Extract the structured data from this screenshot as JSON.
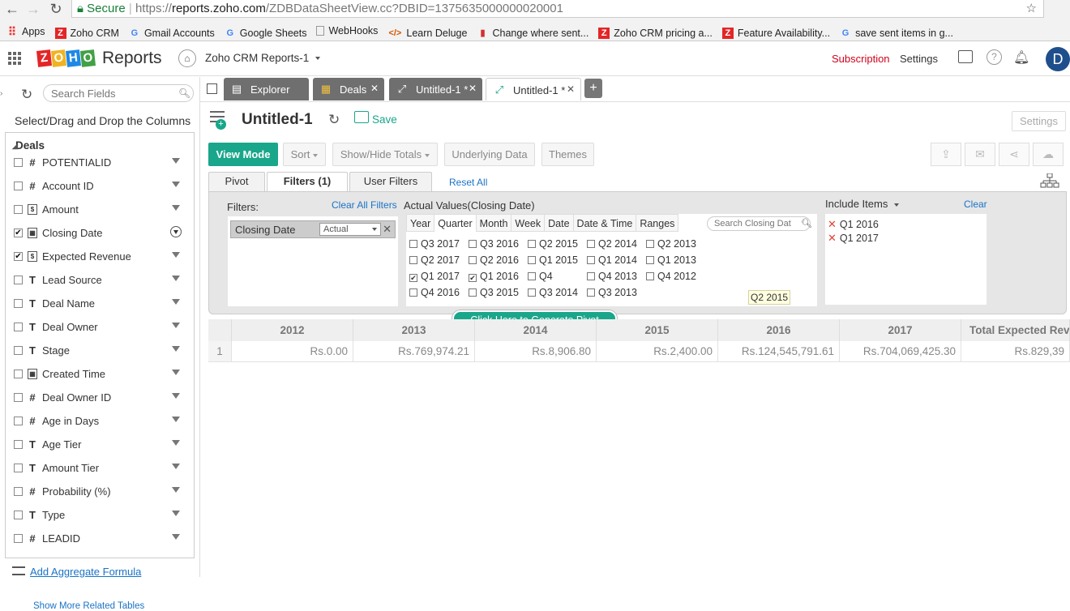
{
  "browser": {
    "secure_label": "Secure",
    "url_scheme": "https://",
    "url_domain": "reports.zoho.com",
    "url_path": "/ZDBDataSheetView.cc?DBID=1375635000000020001",
    "bookmarks": [
      {
        "label": "Apps",
        "icon": "apps-grid-icon"
      },
      {
        "label": "Zoho CRM",
        "icon": "zoho-icon"
      },
      {
        "label": "Gmail Accounts",
        "icon": "google-icon"
      },
      {
        "label": "Google Sheets",
        "icon": "google-icon"
      },
      {
        "label": "WebHooks",
        "icon": "document-icon"
      },
      {
        "label": "Learn Deluge",
        "icon": "code-icon"
      },
      {
        "label": "Change where sent...",
        "icon": "bookmark-red-icon"
      },
      {
        "label": "Zoho CRM pricing a...",
        "icon": "zoho-icon"
      },
      {
        "label": "Feature Availability...",
        "icon": "zoho-icon"
      },
      {
        "label": "save sent items in g...",
        "icon": "google-icon"
      }
    ]
  },
  "app": {
    "logo_letters": [
      "Z",
      "O",
      "H",
      "O"
    ],
    "logo_colors": [
      "#e42527",
      "#f0b323",
      "#1e88e5",
      "#43a047"
    ],
    "title": "Reports",
    "workspace": "Zoho CRM Reports-1",
    "subscription": "Subscription",
    "settings": "Settings",
    "avatar_letter": "D"
  },
  "sidebar": {
    "search_placeholder": "Search Fields",
    "instruction": "Select/Drag and Drop the Columns",
    "table_name": "Deals",
    "fields": [
      {
        "name": "POTENTIALID",
        "type": "#",
        "checked": false,
        "selected": false
      },
      {
        "name": "Account ID",
        "type": "#",
        "checked": false,
        "selected": false
      },
      {
        "name": "Amount",
        "type": "box",
        "checked": false,
        "selected": false
      },
      {
        "name": "Closing Date",
        "type": "cal",
        "checked": true,
        "selected": true
      },
      {
        "name": "Expected Revenue",
        "type": "box",
        "checked": true,
        "selected": false
      },
      {
        "name": "Lead Source",
        "type": "T",
        "checked": false,
        "selected": false
      },
      {
        "name": "Deal Name",
        "type": "T",
        "checked": false,
        "selected": false
      },
      {
        "name": "Deal Owner",
        "type": "T",
        "checked": false,
        "selected": false
      },
      {
        "name": "Stage",
        "type": "T",
        "checked": false,
        "selected": false
      },
      {
        "name": "Created Time",
        "type": "cal",
        "checked": false,
        "selected": false
      },
      {
        "name": "Deal Owner ID",
        "type": "#",
        "checked": false,
        "selected": false
      },
      {
        "name": "Age in Days",
        "type": "#",
        "checked": false,
        "selected": false
      },
      {
        "name": "Age Tier",
        "type": "T",
        "checked": false,
        "selected": false
      },
      {
        "name": "Amount Tier",
        "type": "T",
        "checked": false,
        "selected": false
      },
      {
        "name": "Probability (%)",
        "type": "#",
        "checked": false,
        "selected": false
      },
      {
        "name": "Type",
        "type": "T",
        "checked": false,
        "selected": false
      },
      {
        "name": "LEADID",
        "type": "#",
        "checked": false,
        "selected": false
      }
    ],
    "more_link": "Show More Related Tables",
    "aggregate_link": "Add Aggregate Formula"
  },
  "tabs": [
    {
      "label": "Explorer",
      "icon": "explorer-icon",
      "active": false,
      "closable": false
    },
    {
      "label": "Deals",
      "icon": "table-icon",
      "active": false,
      "closable": true
    },
    {
      "label": "Untitled-1 *",
      "icon": "pivot-icon",
      "active": false,
      "closable": true
    },
    {
      "label": "Untitled-1 *",
      "icon": "pivot-icon",
      "active": true,
      "closable": true
    }
  ],
  "report": {
    "title": "Untitled-1",
    "save": "Save",
    "settings": "Settings",
    "toolbar": {
      "view_mode": "View Mode",
      "sort": "Sort",
      "show_hide": "Show/Hide Totals",
      "underlying": "Underlying Data",
      "themes": "Themes"
    },
    "ptabs": {
      "pivot": "Pivot",
      "filters": "Filters (1)",
      "user_filters": "User Filters",
      "reset_all": "Reset All"
    }
  },
  "filters": {
    "label": "Filters:",
    "clear_all": "Clear All Filters",
    "chip_label": "Closing Date",
    "chip_select": "Actual",
    "actual_title": "Actual Values(Closing Date)",
    "granularity": [
      "Year",
      "Quarter",
      "Month",
      "Week",
      "Date",
      "Date & Time",
      "Ranges"
    ],
    "active_granularity": "Quarter",
    "search_placeholder": "Search Closing Dat",
    "quarter_grid": [
      [
        {
          "l": "Q3 2017",
          "c": false
        },
        {
          "l": "Q3 2016",
          "c": false
        },
        {
          "l": "Q2 2015",
          "c": false
        },
        {
          "l": "Q2 2014",
          "c": false
        },
        {
          "l": "Q2 2013",
          "c": false
        }
      ],
      [
        {
          "l": "Q2 2017",
          "c": false
        },
        {
          "l": "Q2 2016",
          "c": false
        },
        {
          "l": "Q1 2015",
          "c": false
        },
        {
          "l": "Q1 2014",
          "c": false
        },
        {
          "l": "Q1 2013",
          "c": false
        }
      ],
      [
        {
          "l": "Q1 2017",
          "c": true
        },
        {
          "l": "Q1 2016",
          "c": true
        },
        {
          "l": "Q4",
          "c": false
        },
        {
          "l": "Q4 2013",
          "c": false
        },
        {
          "l": "Q4 2012",
          "c": false
        }
      ],
      [
        {
          "l": "Q4 2016",
          "c": false
        },
        {
          "l": "Q3 2015",
          "c": false
        },
        {
          "l": "Q3 2014",
          "c": false
        },
        {
          "l": "Q3 2013",
          "c": false
        }
      ]
    ],
    "tooltip": "Q2 2015",
    "include_title": "Include Items",
    "include_clear": "Clear",
    "include_items": [
      "Q1 2016",
      "Q1 2017"
    ],
    "generate": "Click Here to Generate Pivot"
  },
  "grid": {
    "headers": [
      "",
      "2012",
      "2013",
      "2014",
      "2015",
      "2016",
      "2017",
      "Total Expected Rev"
    ],
    "rows": [
      [
        "1",
        "Rs.0.00",
        "Rs.769,974.21",
        "Rs.8,906.80",
        "Rs.2,400.00",
        "Rs.124,545,791.61",
        "Rs.704,069,425.30",
        "Rs.829,39"
      ]
    ]
  }
}
